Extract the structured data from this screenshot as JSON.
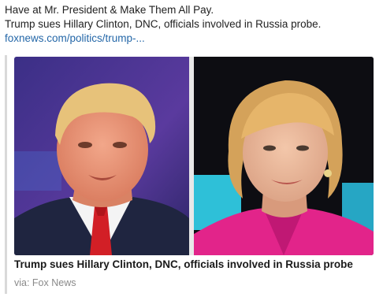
{
  "post": {
    "line1": "Have at Mr. President & Make Them All Pay.",
    "line2": "Trump sues Hillary Clinton, DNC, officials involved in Russia probe.",
    "link_text": "foxnews.com/politics/trump-..."
  },
  "card": {
    "title": "Trump sues Hillary Clinton, DNC, officials involved in Russia probe",
    "source": "via: Fox News",
    "images": [
      {
        "name": "trump-photo"
      },
      {
        "name": "clinton-photo"
      }
    ]
  },
  "colors": {
    "link": "#2467a8",
    "card_border": "#d9d9d9",
    "source_text": "#8a8a8a"
  }
}
